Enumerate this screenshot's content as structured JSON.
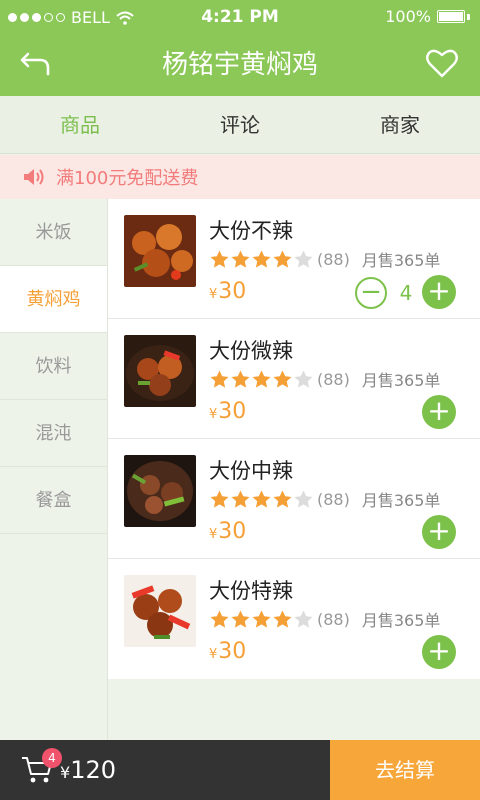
{
  "status_bar": {
    "carrier": "BELL",
    "time": "4:21 PM",
    "battery": "100%"
  },
  "header": {
    "title": "杨铭宇黄焖鸡"
  },
  "tabs": [
    {
      "label": "商品"
    },
    {
      "label": "评论"
    },
    {
      "label": "商家"
    }
  ],
  "notice": {
    "text": "满100元免配送费"
  },
  "sidebar": {
    "items": [
      {
        "label": "米饭"
      },
      {
        "label": "黄焖鸡"
      },
      {
        "label": "饮料"
      },
      {
        "label": "混沌"
      },
      {
        "label": "餐盒"
      }
    ]
  },
  "products": [
    {
      "name": "大份不辣",
      "rating": 4,
      "reviews": "(88)",
      "sales": "月售365单",
      "currency": "¥",
      "price": "30",
      "quantity": "4"
    },
    {
      "name": "大份微辣",
      "rating": 4,
      "reviews": "(88)",
      "sales": "月售365单",
      "currency": "¥",
      "price": "30"
    },
    {
      "name": "大份中辣",
      "rating": 4,
      "reviews": "(88)",
      "sales": "月售365单",
      "currency": "¥",
      "price": "30"
    },
    {
      "name": "大份特辣",
      "rating": 4,
      "reviews": "(88)",
      "sales": "月售365单",
      "currency": "¥",
      "price": "30"
    }
  ],
  "footer": {
    "cart_count": "4",
    "currency": "¥",
    "total": "120",
    "checkout_label": "去结算"
  },
  "colors": {
    "accent": "#8bc858",
    "price": "#f5a037",
    "badge": "#f0536b",
    "checkout": "#f7a63a"
  },
  "icons": {
    "back": "back-arrow-icon",
    "favorite": "heart-icon",
    "speaker": "speaker-icon",
    "cart": "cart-icon",
    "star": "star-icon"
  }
}
